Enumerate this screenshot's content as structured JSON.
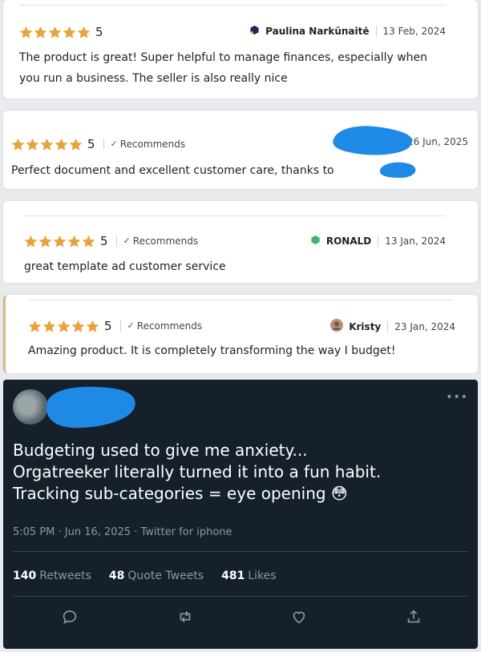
{
  "colors": {
    "star": "#e8a33d",
    "page_bg": "#e9eaee",
    "tweet_bg": "#15202b",
    "tweet_muted": "#8b98a5",
    "redaction": "#1f8ae6"
  },
  "reviews": [
    {
      "rating": 5,
      "score": "5",
      "recommends": "",
      "author": "Paulina Narkūnaitė",
      "author_icon": "navy-hexagon-icon",
      "date": "13 Feb, 2024",
      "text": "The product is great! Super helpful to manage finances, especially when you run a business. The seller is also really nice"
    },
    {
      "rating": 5,
      "score": "5",
      "recommends": "Recommends",
      "author": "",
      "date": "26 Jun, 2025",
      "text": "Perfect document and excellent customer care, thanks to"
    },
    {
      "rating": 5,
      "score": "5",
      "recommends": "Recommends",
      "author": "RONALD",
      "author_icon": "green-hexagon-icon",
      "date": "13 Jan, 2024",
      "text": "great template ad customer service"
    },
    {
      "rating": 5,
      "score": "5",
      "recommends": "Recommends",
      "author": "Kristy",
      "author_icon": "avatar-photo-icon",
      "date": "23 Jan, 2024",
      "text": "Amazing product. It is completely transforming the way I budget!"
    }
  ],
  "tweet": {
    "more_icon": "more-horizontal-icon",
    "lines": [
      "Budgeting used to give me anxiety...",
      "Orgatreeker literally turned it into a fun habit.",
      "Tracking sub-categories = eye opening 😳"
    ],
    "meta": "5:05 PM · Jun 16, 2025 · Twitter for iphone",
    "retweets_count": "140",
    "retweets_label": "Retweets",
    "quotes_count": "48",
    "quotes_label": "Quote Tweets",
    "likes_count": "481",
    "likes_label": "Likes",
    "actions": [
      "reply-icon",
      "retweet-icon",
      "like-icon",
      "share-icon"
    ]
  }
}
